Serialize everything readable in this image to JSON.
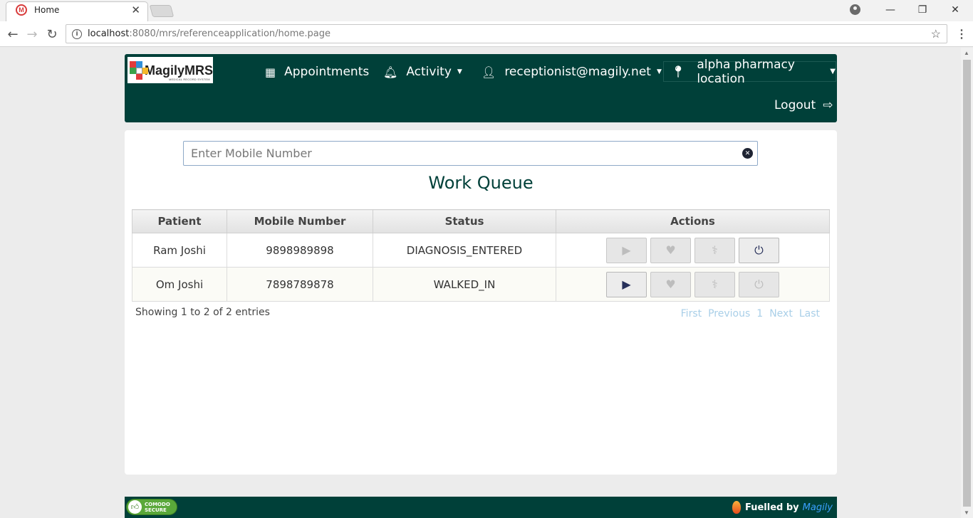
{
  "browser": {
    "tab_title": "Home",
    "url_host": "localhost",
    "url_rest": ":8080/mrs/referenceapplication/home.page",
    "window_controls": {
      "minimize": "—",
      "restore": "❐",
      "close": "✕"
    }
  },
  "header": {
    "logo_text": "MagilyMRS",
    "logo_sub": "MEDICAL RECORD SYSTEM",
    "nav": {
      "appointments": "Appointments",
      "activity": "Activity",
      "user": "receptionist@magily.net"
    },
    "location": "alpha pharmacy location",
    "logout": "Logout"
  },
  "search": {
    "placeholder": "Enter Mobile Number",
    "value": ""
  },
  "work_queue": {
    "title": "Work Queue",
    "columns": [
      "Patient",
      "Mobile Number",
      "Status",
      "Actions"
    ],
    "rows": [
      {
        "patient": "Ram Joshi",
        "mobile": "9898989898",
        "status": "DIAGNOSIS_ENTERED"
      },
      {
        "patient": "Om Joshi",
        "mobile": "7898789878",
        "status": "WALKED_IN"
      }
    ],
    "entries_info": "Showing 1 to 2 of 2 entries",
    "pager": {
      "first": "First",
      "previous": "Previous",
      "page": "1",
      "next": "Next",
      "last": "Last"
    }
  },
  "footer": {
    "comodo_line1": "COMODO",
    "comodo_line2": "SECURE",
    "fuelled_by": "Fuelled by",
    "brand": "Magily"
  },
  "colors": {
    "brand_green": "#004039",
    "pager_link": "#a9cfe8",
    "button_icon_enabled": "#27305a"
  }
}
